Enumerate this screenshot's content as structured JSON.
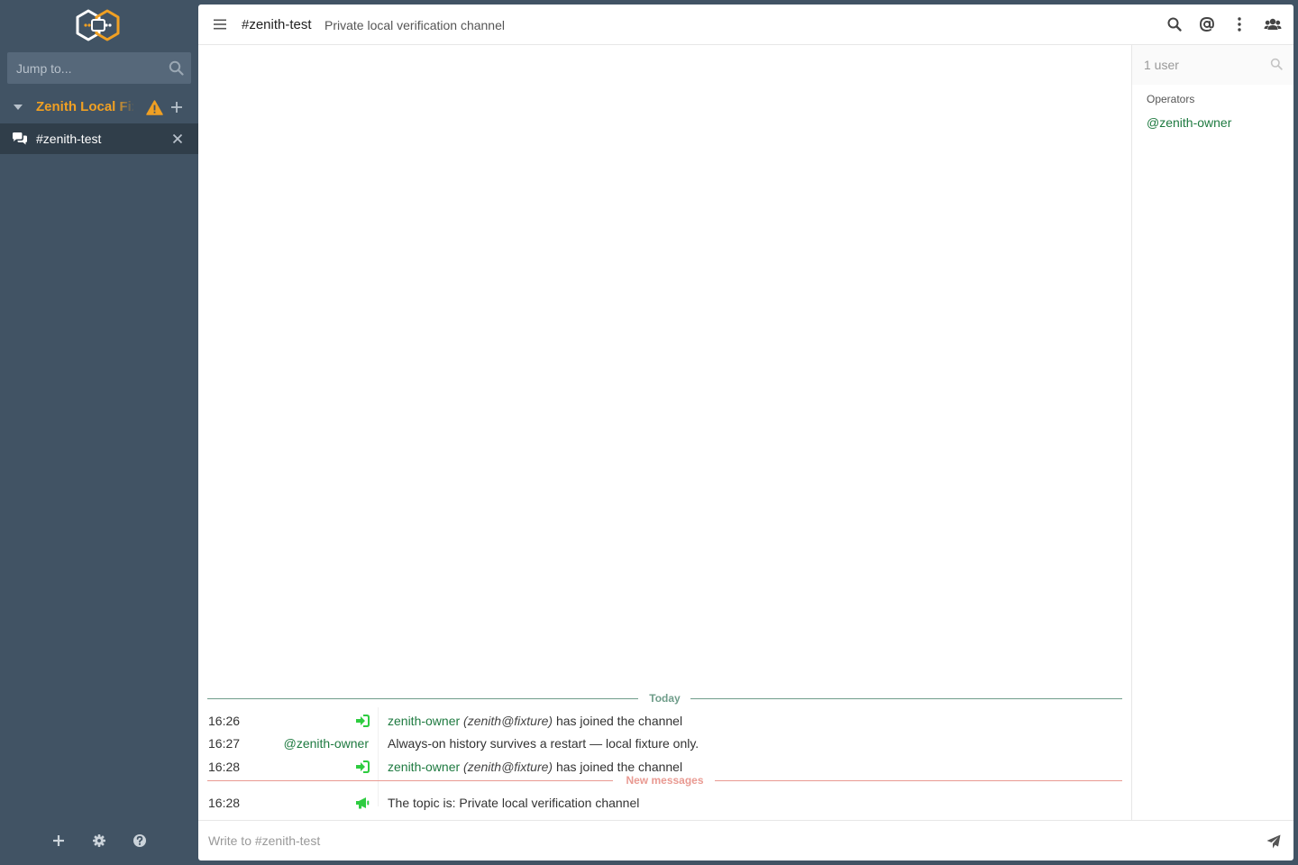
{
  "sidebar": {
    "logo_icon": "thelounge-logo-icon",
    "jump_placeholder": "Jump to...",
    "network": {
      "name": "Zenith Local Fixture",
      "warning_icon": "warning-icon"
    },
    "channels": [
      {
        "name": "#zenith-test",
        "icon": "chat-icon",
        "active": true
      }
    ],
    "footer": {
      "connect_icon": "plus-icon",
      "settings_icon": "gear-icon",
      "help_icon": "help-icon"
    }
  },
  "header": {
    "channel": "#zenith-test",
    "topic": "Private local verification channel",
    "buttons": [
      "search-icon",
      "mention-icon",
      "more-icon",
      "users-icon"
    ]
  },
  "chat": {
    "date_divider": "Today",
    "unread_divider": "New messages",
    "messages": [
      {
        "time": "16:26",
        "type": "join",
        "nick": "zenith-owner",
        "host": "(zenith@fixture)",
        "text": "has joined the channel"
      },
      {
        "time": "16:27",
        "type": "message",
        "from": "@zenith-owner",
        "text": "Always-on history survives a restart — local fixture only."
      },
      {
        "time": "16:28",
        "type": "join",
        "nick": "zenith-owner",
        "host": "(zenith@fixture)",
        "text": "has joined the channel"
      },
      {
        "time": "16:28",
        "type": "topic",
        "text": "The topic is: Private local verification channel"
      }
    ]
  },
  "userlist": {
    "search_placeholder": "1 user",
    "group": "Operators",
    "users": [
      "@zenith-owner"
    ]
  },
  "composer": {
    "placeholder": "Write to #zenith-test"
  },
  "colors": {
    "sidebar_bg": "#415364",
    "active_channel_bg": "#303e4a",
    "network_accent": "#f0a023",
    "nick_green": "#1e7a40",
    "join_icon_green": "#2ecc40",
    "date_divider": "#6f9d8a",
    "unread_divider": "#e99a92"
  }
}
